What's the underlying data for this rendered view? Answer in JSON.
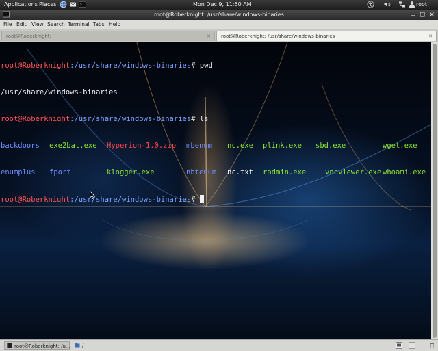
{
  "top_panel": {
    "applications": "Applications",
    "places": "Places",
    "clock": "Mon Dec  9, 11:50 AM",
    "user": "root"
  },
  "window": {
    "title": "root@Roberknight: /usr/share/windows-binaries",
    "menu": [
      "File",
      "Edit",
      "View",
      "Search",
      "Terminal",
      "Tabs",
      "Help"
    ],
    "tabs": [
      {
        "label": "root@Roberknight: ~",
        "active": false
      },
      {
        "label": "root@Roberknight: /usr/share/windows-binaries",
        "active": true
      }
    ]
  },
  "terminal": {
    "user_host": "root@Roberknight",
    "path": ":/usr/share/windows-binaries",
    "prompt_symbol": "#",
    "commands": [
      " pwd",
      " ls"
    ],
    "pwd_output": "/usr/share/windows-binaries",
    "ls_row1": [
      {
        "name": "backdoors",
        "type": "dir"
      },
      {
        "name": "exe2bat.exe",
        "type": "exe"
      },
      {
        "name": "Hyperion-1.0.zip",
        "type": "zip"
      },
      {
        "name": "mbenum",
        "type": "dir"
      },
      {
        "name": "nc.exe",
        "type": "exe"
      },
      {
        "name": "plink.exe",
        "type": "exe"
      },
      {
        "name": "sbd.exe",
        "type": "exe"
      },
      {
        "name": "wget.exe",
        "type": "exe"
      }
    ],
    "ls_row2": [
      {
        "name": "enumplus",
        "type": "dir"
      },
      {
        "name": "fport",
        "type": "dir"
      },
      {
        "name": "klogger.exe",
        "type": "exe"
      },
      {
        "name": "nbtenum",
        "type": "dir"
      },
      {
        "name": "nc.txt",
        "type": "file"
      },
      {
        "name": "radmin.exe",
        "type": "exe"
      },
      {
        "name": "vncviewer.exe",
        "type": "exe"
      },
      {
        "name": "whoami.exe",
        "type": "exe"
      }
    ]
  },
  "taskbar": {
    "terminal_task": "root@Roberknight: /u...",
    "folder_task": "/"
  },
  "colors": {
    "prompt_user": "#ff5555",
    "prompt_path": "#7ea3ff",
    "directory": "#6f8fff",
    "executable": "#8be234",
    "archive": "#ff4a4a"
  },
  "icons": {
    "browser": "globe-icon",
    "mail": "envelope-icon",
    "terminal": "terminal-icon",
    "accessibility": "accessibility-icon",
    "volume": "speaker-icon",
    "network": "network-icon",
    "user": "user-icon"
  }
}
